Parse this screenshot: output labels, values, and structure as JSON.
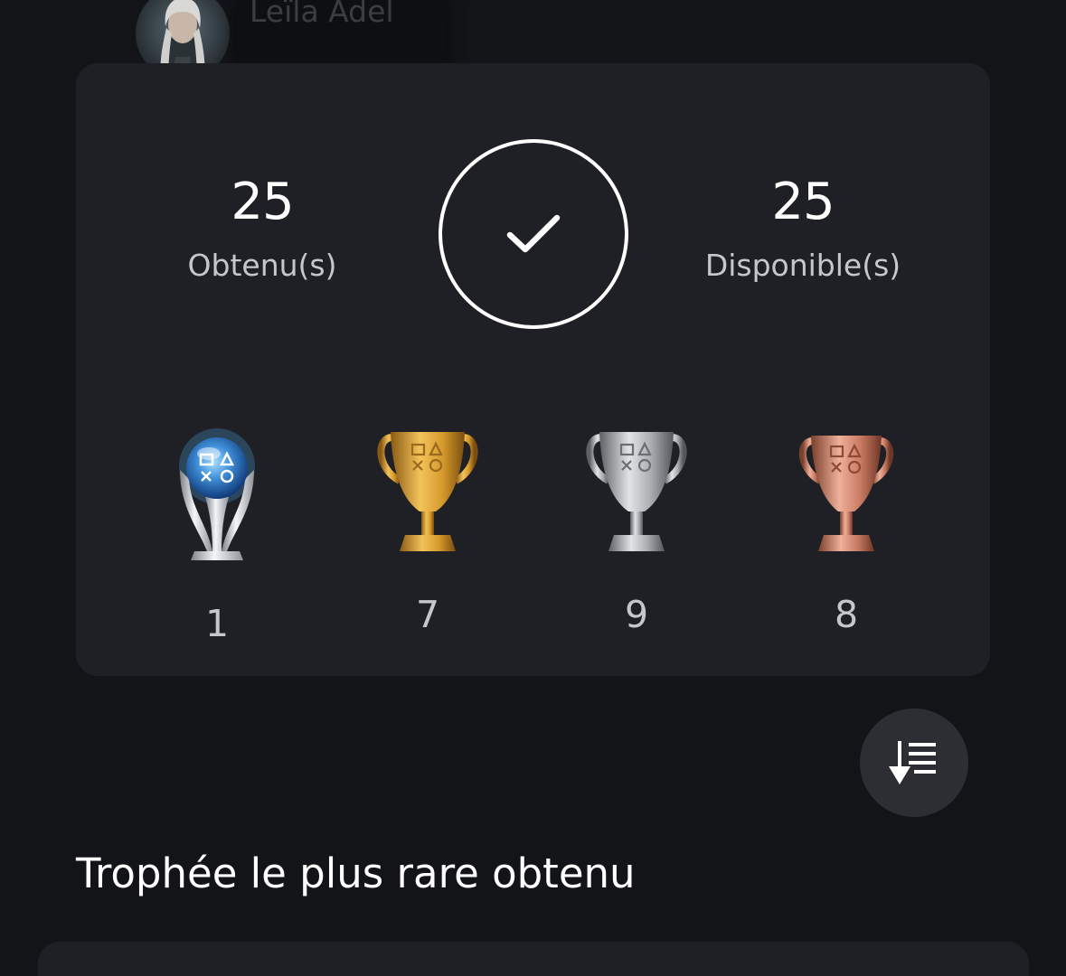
{
  "user": {
    "name": "Leïla Adel",
    "avatar_icon": "user-avatar"
  },
  "summary": {
    "earned_value": "25",
    "earned_label": "Obtenu(s)",
    "available_value": "25",
    "available_label": "Disponible(s)",
    "status_icon": "check-icon"
  },
  "trophies": [
    {
      "type": "platinum",
      "icon": "platinum-trophy-icon",
      "count": "1",
      "color": "#7fb6e8"
    },
    {
      "type": "gold",
      "icon": "gold-trophy-icon",
      "count": "7",
      "color": "#d69a2b"
    },
    {
      "type": "silver",
      "icon": "silver-trophy-icon",
      "count": "9",
      "color": "#b3b3b3"
    },
    {
      "type": "bronze",
      "icon": "bronze-trophy-icon",
      "count": "8",
      "color": "#c97b63"
    }
  ],
  "sort_button": {
    "icon": "sort-descending-icon"
  },
  "rarest_section": {
    "title": "Trophée le plus rare obtenu"
  }
}
